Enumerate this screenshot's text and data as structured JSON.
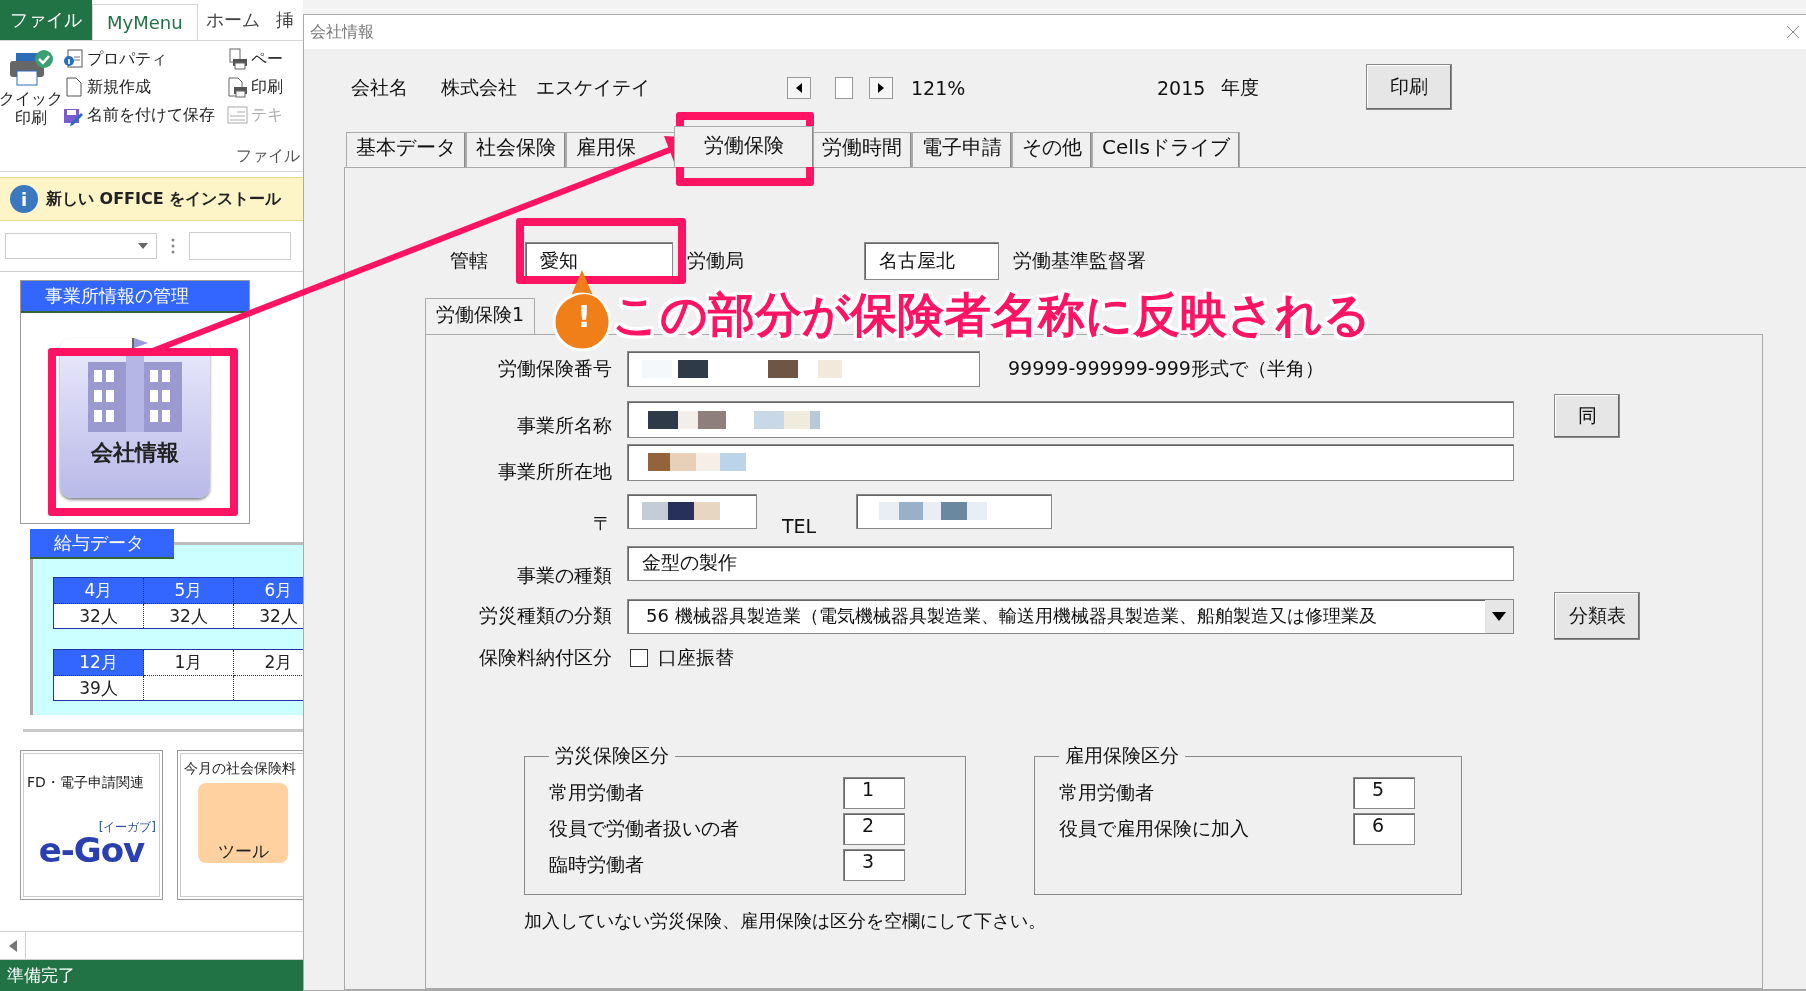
{
  "excel": {
    "ribbon_tabs": [
      {
        "label": "ファイル",
        "kind": "file",
        "selected": false
      },
      {
        "label": "MyMenu",
        "kind": "tab",
        "selected": true
      },
      {
        "label": "ホーム",
        "kind": "tab",
        "selected": false
      },
      {
        "label": "挿",
        "kind": "tab",
        "selected": false
      }
    ],
    "quick_print": "クイック印刷",
    "ribbon_columns": [
      {
        "items": [
          {
            "label": "プロパティ",
            "kind": "properties",
            "disabled": false
          },
          {
            "label": "新規作成",
            "kind": "new",
            "disabled": false
          },
          {
            "label": "名前を付けて保存",
            "kind": "save",
            "disabled": false
          }
        ]
      },
      {
        "items": [
          {
            "label": "ペー",
            "kind": "page",
            "disabled": false
          },
          {
            "label": "印刷",
            "kind": "printarea",
            "disabled": false
          },
          {
            "label": "テキ",
            "kind": "text",
            "disabled": true
          }
        ]
      }
    ],
    "group_label": "ファイル",
    "info_icon": "i",
    "info_bar": "新しい OFFICE をインストール",
    "office_panel": {
      "title": "事業所情報の管理",
      "button": "会社情報"
    },
    "salary": {
      "title": "給与データ",
      "rows": [
        {
          "headers": [
            {
              "label": "4月",
              "highlighted": true
            },
            {
              "label": "5月",
              "highlighted": true
            },
            {
              "label": "6月",
              "highlighted": true
            }
          ],
          "values": [
            "32人",
            "32人",
            "32人"
          ]
        },
        {
          "headers": [
            {
              "label": "12月",
              "highlighted": true
            },
            {
              "label": "1月",
              "highlighted": false
            },
            {
              "label": "2月",
              "highlighted": false
            }
          ],
          "values": [
            "39人"
          ]
        }
      ]
    },
    "cards": [
      {
        "kind": "egov",
        "text": "FD・電子申請関連",
        "logo": "e-Gov",
        "logo_sub": "[イーガブ]"
      },
      {
        "kind": "tool",
        "text": "今月の社会保険料",
        "logo": "ツール"
      }
    ],
    "status": "準備完了"
  },
  "dialog": {
    "title": "会社情報",
    "company_label": "会社名",
    "company_name": "株式会社　エスケイテイ",
    "zoom": "121%",
    "year": "2015",
    "year_label": "年度",
    "print_button": "印刷",
    "tabs": [
      {
        "label": "基本データ",
        "selected": false
      },
      {
        "label": "社会保険",
        "selected": false
      },
      {
        "label": "雇用保",
        "selected": false
      },
      {
        "label": "労働保険",
        "selected": true
      },
      {
        "label": "労働時間",
        "selected": false
      },
      {
        "label": "電子申請",
        "selected": false
      },
      {
        "label": "その他",
        "selected": false
      },
      {
        "label": "Cellsドライブ",
        "selected": false
      }
    ],
    "jurisdiction": {
      "label": "管轄",
      "prefecture": "愛知",
      "prefecture_suffix": "労働局",
      "office": "名古屋北",
      "office_suffix": "労働基準監督署"
    },
    "sub_tabs": [
      {
        "label": "労働保険1",
        "selected": true
      }
    ],
    "insurance_no": {
      "label": "労働保険番号",
      "hint": "99999-999999-999形式で（半角）"
    },
    "office_name": {
      "label": "事業所名称",
      "button": "同"
    },
    "address": {
      "label": "事業所所在地"
    },
    "zip": {
      "label": "〒"
    },
    "tel": {
      "label": "TEL"
    },
    "business": {
      "label": "事業の種類",
      "value": "金型の製作"
    },
    "category": {
      "label": "労災種類の分類",
      "value": "56 機械器具製造業（電気機械器具製造業、輸送用機械器具製造業、船舶製造又は修理業及",
      "button": "分類表"
    },
    "payment": {
      "label": "保険料納付区分",
      "checkbox": "口座振替",
      "checked": false
    },
    "groups": [
      {
        "title": "労災保険区分",
        "rows": [
          {
            "label": "常用労働者",
            "value": "1"
          },
          {
            "label": "役員で労働者扱いの者",
            "value": "2"
          },
          {
            "label": "臨時労働者",
            "value": "3"
          }
        ]
      },
      {
        "title": "雇用保険区分",
        "rows": [
          {
            "label": "常用労働者",
            "value": "5"
          },
          {
            "label": "役員で雇用保険に加入",
            "value": "6"
          }
        ]
      }
    ],
    "note": "加入していない労災保険、雇用保険は区分を空欄にして下さい。"
  },
  "annotation": {
    "icon": "!",
    "text": "この部分が保険者名称に反映される"
  }
}
